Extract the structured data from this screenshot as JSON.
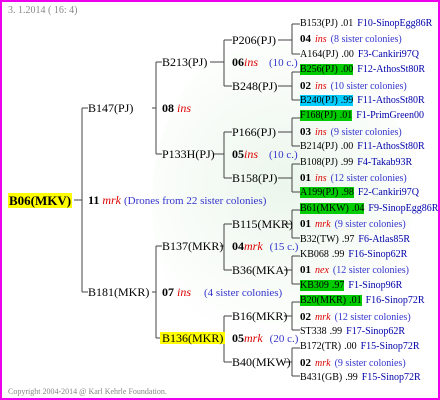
{
  "header": {
    "date": "3. 1.2014 ( 16: 4)"
  },
  "footer": {
    "copyright": "Copyright 2004-2014 @ Karl Kehrle Foundation."
  },
  "root": {
    "label": "B06(MKV)"
  },
  "gen1": {
    "father": {
      "label": "B147(PJ)"
    },
    "mother": {
      "label": "B181(MKR)"
    },
    "mid": {
      "num": "11",
      "ins": "mrk",
      "text": "(Drones from 22 sister colonies)"
    }
  },
  "gen2": {
    "a": {
      "label": "B213(PJ)"
    },
    "a_mid": {
      "num": "08",
      "ins": "ins"
    },
    "b": {
      "label": "P133H(PJ)"
    },
    "c": {
      "label": "B137(MKR)"
    },
    "d": {
      "label": "B136(MKR)"
    },
    "d_mid": {
      "num": "07",
      "ins": "ins",
      "text": "(4 sister colonies)"
    }
  },
  "gen3": [
    {
      "label": "P206(PJ)"
    },
    {
      "mid_num": "06",
      "mid_ins": "ins",
      "mid_text": "(10 c.)"
    },
    {
      "label": "B248(PJ)"
    },
    {
      "label": "P166(PJ)"
    },
    {
      "mid_num": "05",
      "mid_ins": "ins",
      "mid_text": "(10 c.)"
    },
    {
      "label": "B158(PJ)"
    },
    {
      "label": "B115(MKR)"
    },
    {
      "mid_num": "04",
      "mid_ins": "mrk",
      "mid_text": "(15 c.)"
    },
    {
      "label": "B36(MKA)"
    },
    {
      "label": "B16(MKR)"
    },
    {
      "mid_num": "05",
      "mid_ins": "mrk",
      "mid_text": "(20 c.)"
    },
    {
      "label": "B40(MKW)"
    }
  ],
  "gen4": [
    {
      "name": "B153(PJ)",
      "val": ".01",
      "code": "F10",
      "ref": "-SinopEgg86R"
    },
    {
      "num": "04",
      "ins": "ins",
      "text": "(8 sister colonies)"
    },
    {
      "name": "A164(PJ)",
      "val": ".00",
      "code": "F3",
      "ref": "-Cankiri97Q"
    },
    {
      "name": "B256(PJ)",
      "val": ".00",
      "code": "F12",
      "ref": "-AthosSt80R"
    },
    {
      "num": "02",
      "ins": "ins",
      "text": "(10 sister colonies)"
    },
    {
      "name": "B240(PJ)",
      "val": ".99",
      "code": "F11",
      "ref": "-AthosSt80R"
    },
    {
      "name": "F168(PJ)",
      "val": ".01",
      "code": "F1",
      "ref": "-PrimGreen00"
    },
    {
      "num": "03",
      "ins": "ins",
      "text": "(9 sister colonies)"
    },
    {
      "name": "B214(PJ)",
      "val": ".00",
      "code": "F11",
      "ref": "-AthosSt80R"
    },
    {
      "name": "B108(PJ)",
      "val": ".99",
      "code": "F4",
      "ref": "-Takab93R"
    },
    {
      "num": "01",
      "ins": "ins",
      "text": "(12 sister colonies)"
    },
    {
      "name": "A199(PJ)",
      "val": ".98",
      "code": "F2",
      "ref": "-Cankiri97Q"
    },
    {
      "name": "B61(MKW)",
      "val": ".04",
      "code": "F9",
      "ref": "-SinopEgg86R"
    },
    {
      "num": "01",
      "ins": "mrk",
      "text": "(9 sister colonies)"
    },
    {
      "name": "B32(TW)",
      "val": ".97",
      "code": "F6",
      "ref": "-Atlas85R"
    },
    {
      "name": "KB068",
      "val": ".99",
      "code": "F16",
      "ref": "-Sinop62R"
    },
    {
      "num": "01",
      "ins": "nex",
      "text": "(12 sister colonies)"
    },
    {
      "name": "KB309",
      "val": ".97",
      "code": "F1",
      "ref": "-Sinop96R"
    },
    {
      "name": "B20(MKR)",
      "val": ".01",
      "code": "F16",
      "ref": "-Sinop72R"
    },
    {
      "num": "02",
      "ins": "mrk",
      "text": "(12 sister colonies)"
    },
    {
      "name": "ST338",
      "val": ".99",
      "code": "F17",
      "ref": "-Sinop62R"
    },
    {
      "name": "B172(TR)",
      "val": ".00",
      "code": "F15",
      "ref": "-Sinop72R"
    },
    {
      "num": "02",
      "ins": "mrk",
      "text": "(9 sister colonies)"
    },
    {
      "name": "B431(GB)",
      "val": ".99",
      "code": "F15",
      "ref": "-Sinop72R"
    }
  ]
}
